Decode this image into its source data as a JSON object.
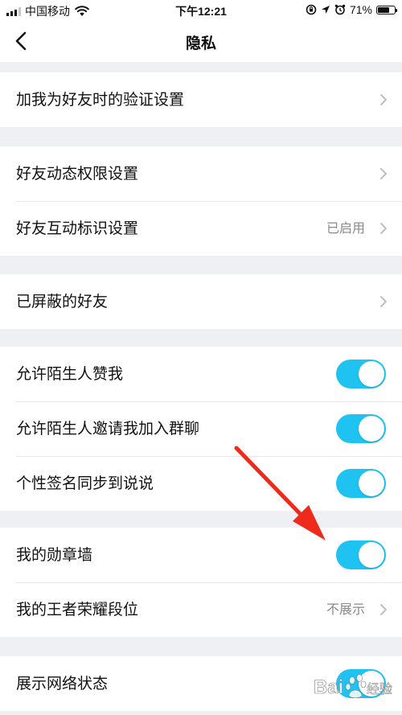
{
  "status_bar": {
    "carrier": "中国移动",
    "time": "下午12:21",
    "battery_percent": "71%",
    "battery_level": 0.71,
    "icons": [
      "signal-icon",
      "wifi-icon",
      "rotation-lock-icon",
      "location-icon",
      "alarm-icon",
      "battery-icon"
    ]
  },
  "nav": {
    "back_icon": "chevron-left-icon",
    "title": "隐私"
  },
  "groups": [
    {
      "rows": [
        {
          "label": "加我为好友时的验证设置",
          "control": "chevron"
        }
      ]
    },
    {
      "rows": [
        {
          "label": "好友动态权限设置",
          "control": "chevron"
        },
        {
          "label": "好友互动标识设置",
          "value": "已启用",
          "control": "chevron"
        }
      ]
    },
    {
      "rows": [
        {
          "label": "已屏蔽的好友",
          "control": "chevron"
        }
      ]
    },
    {
      "rows": [
        {
          "label": "允许陌生人赞我",
          "control": "toggle",
          "on": true
        },
        {
          "label": "允许陌生人邀请我加入群聊",
          "control": "toggle",
          "on": true
        },
        {
          "label": "个性签名同步到说说",
          "control": "toggle",
          "on": true
        }
      ]
    },
    {
      "rows": [
        {
          "label": "我的勋章墙",
          "control": "toggle",
          "on": true
        },
        {
          "label": "我的王者荣耀段位",
          "value": "不展示",
          "control": "chevron"
        }
      ]
    },
    {
      "rows": [
        {
          "label": "展示网络状态",
          "control": "toggle",
          "on": true
        }
      ]
    }
  ],
  "colors": {
    "toggle_on": "#1ec3f2",
    "background": "#eff0f4",
    "annotation_arrow": "#ee2a1a"
  },
  "watermark": {
    "text": "Bai du 经验"
  }
}
